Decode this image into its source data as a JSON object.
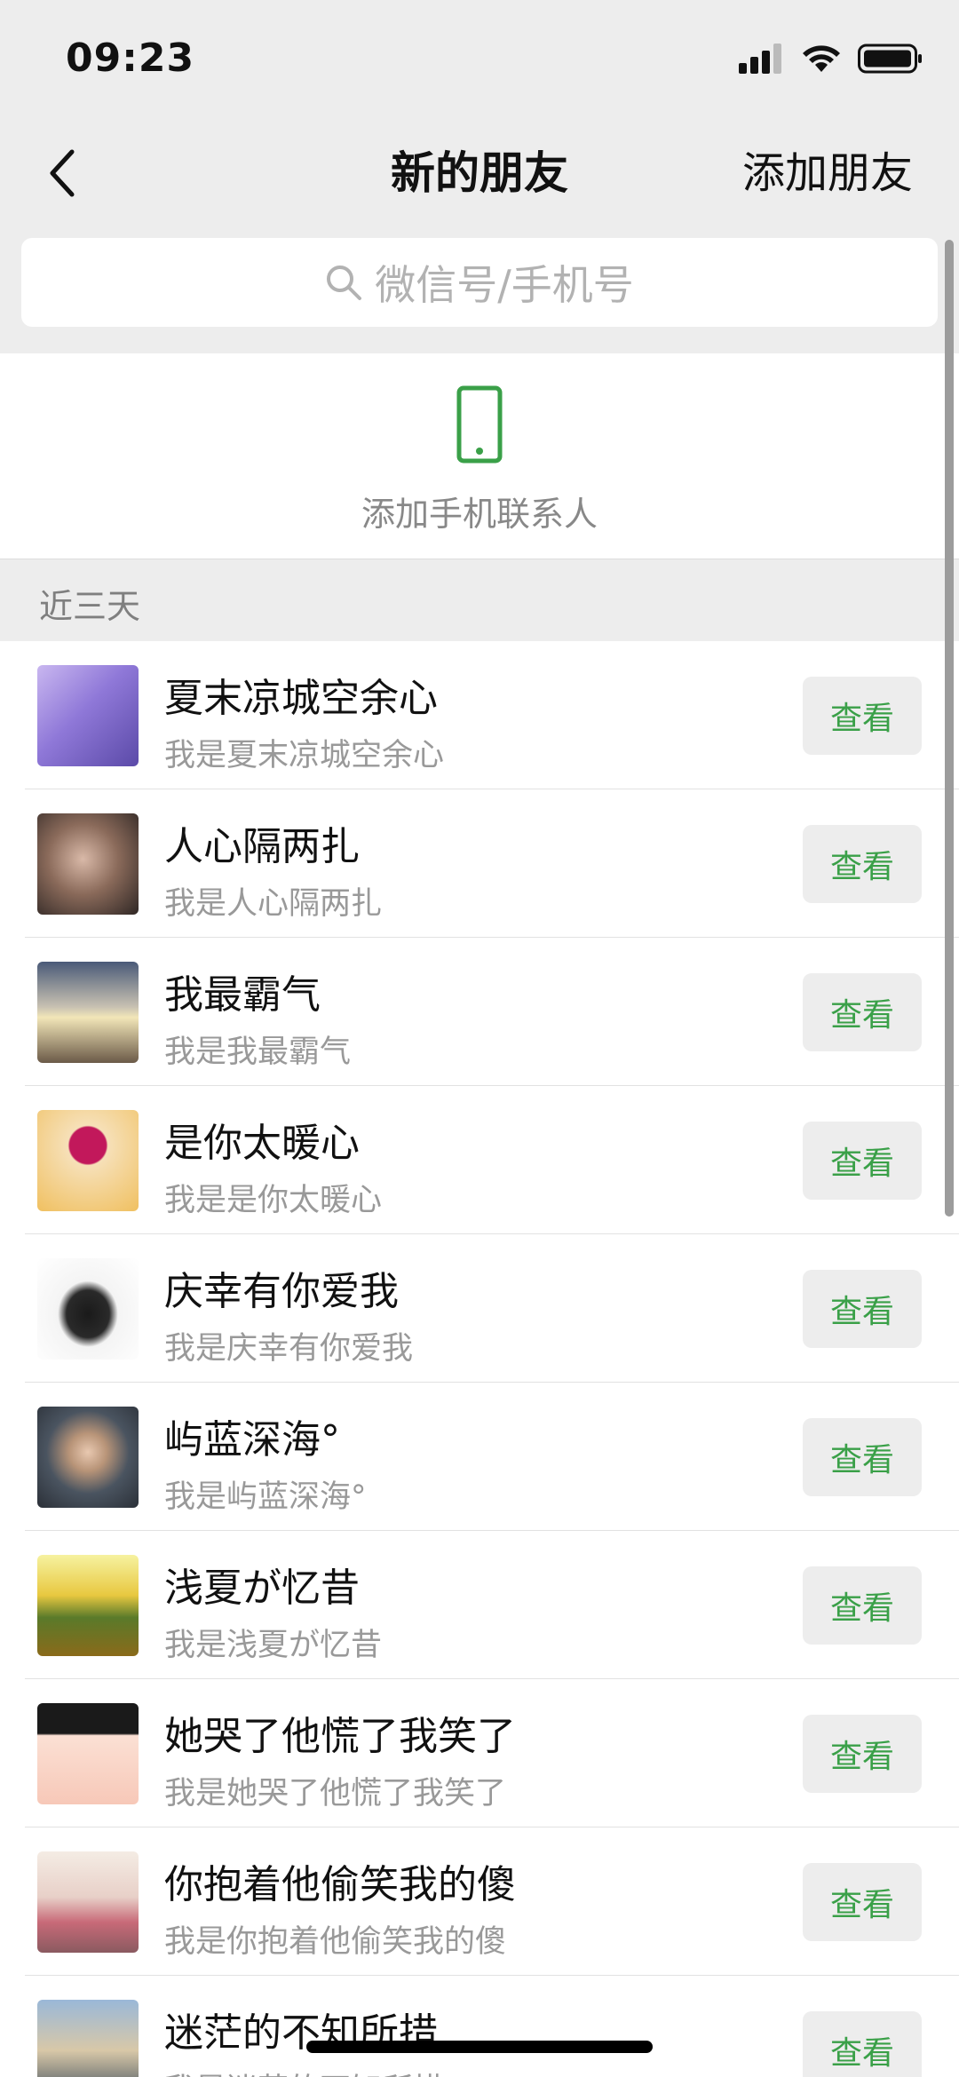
{
  "status": {
    "time": "09:23"
  },
  "nav": {
    "title": "新的朋友",
    "action": "添加朋友"
  },
  "search": {
    "placeholder": "微信号/手机号"
  },
  "add_phone": {
    "label": "添加手机联系人"
  },
  "section": {
    "label": "近三天"
  },
  "list": [
    {
      "name": "夏末凉城空余心",
      "sub": "我是夏末凉城空余心",
      "button": "查看"
    },
    {
      "name": "人心隔两扎",
      "sub": "我是人心隔两扎",
      "button": "查看"
    },
    {
      "name": "我最霸气",
      "sub": "我是我最霸气",
      "button": "查看"
    },
    {
      "name": "是你太暖心",
      "sub": "我是是你太暖心",
      "button": "查看"
    },
    {
      "name": "庆幸有你爱我",
      "sub": "我是庆幸有你爱我",
      "button": "查看"
    },
    {
      "name": "屿蓝深海°",
      "sub": "我是屿蓝深海°",
      "button": "查看"
    },
    {
      "name": "浅夏が忆昔",
      "sub": "我是浅夏が忆昔",
      "button": "查看"
    },
    {
      "name": "她哭了他慌了我笑了",
      "sub": "我是她哭了他慌了我笑了",
      "button": "查看"
    },
    {
      "name": "你抱着他偷笑我的傻",
      "sub": "我是你抱着他偷笑我的傻",
      "button": "查看"
    },
    {
      "name": "迷茫的不知所措…",
      "sub": "我是迷茫的不知所措",
      "button": "查看"
    }
  ],
  "colors": {
    "accent_green": "#3aa048",
    "background": "#ededed"
  }
}
